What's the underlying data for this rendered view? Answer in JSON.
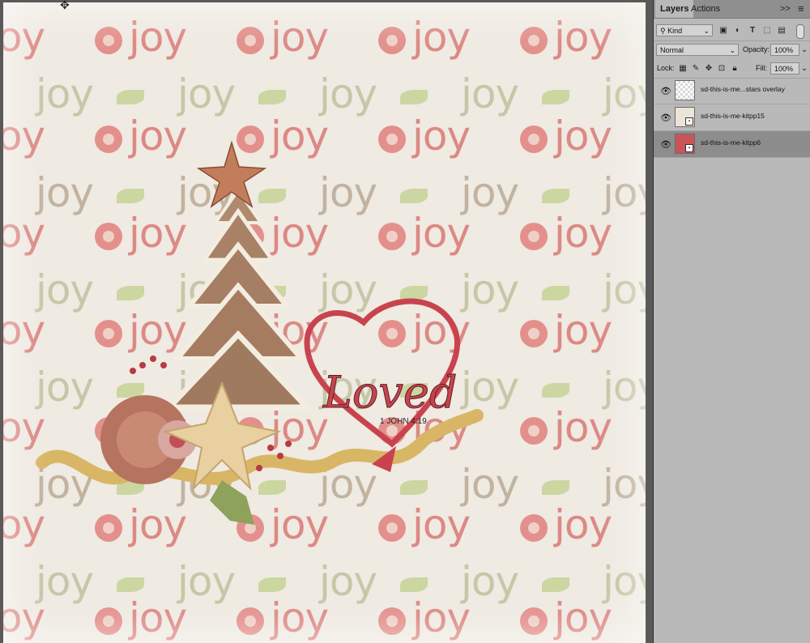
{
  "panel": {
    "tabs": [
      {
        "label": "Layers"
      },
      {
        "label": "Actions"
      }
    ],
    "collapse_label": ">>",
    "menu_icon": "hamburger-menu-icon",
    "filter": {
      "value": "Kind",
      "icons": [
        "image-filter-icon",
        "adjustment-filter-icon",
        "type-filter-icon",
        "shape-filter-icon",
        "smart-object-filter-icon"
      ]
    },
    "blend": {
      "value": "Normal",
      "opacity_label": "Opacity:",
      "opacity_value": "100%"
    },
    "lock": {
      "label": "Lock:",
      "icons": [
        "lock-transparent-icon",
        "lock-image-icon",
        "lock-position-icon",
        "lock-artboard-icon",
        "lock-all-icon"
      ],
      "fill_label": "Fill:",
      "fill_value": "100%"
    },
    "layers": [
      {
        "name": "sd-this-is-me...stars overlay",
        "visible": true,
        "selected": false,
        "thumb": "transparent"
      },
      {
        "name": "sd-this-is-me-kitpp15",
        "visible": true,
        "selected": false,
        "thumb": "paper"
      },
      {
        "name": "sd-this-is-me-kitpp6",
        "visible": true,
        "selected": true,
        "thumb": "red"
      }
    ]
  },
  "canvas": {
    "pattern_word": "joy",
    "title_word": "Loved",
    "verse": "1 JOHN 4:19"
  },
  "colors": {
    "panel_bg": "#b9b9b9",
    "paper": "#efeae2",
    "joy_red": "#dc8985",
    "joy_green": "#c6c7a7",
    "heart_red": "#c9434f"
  }
}
